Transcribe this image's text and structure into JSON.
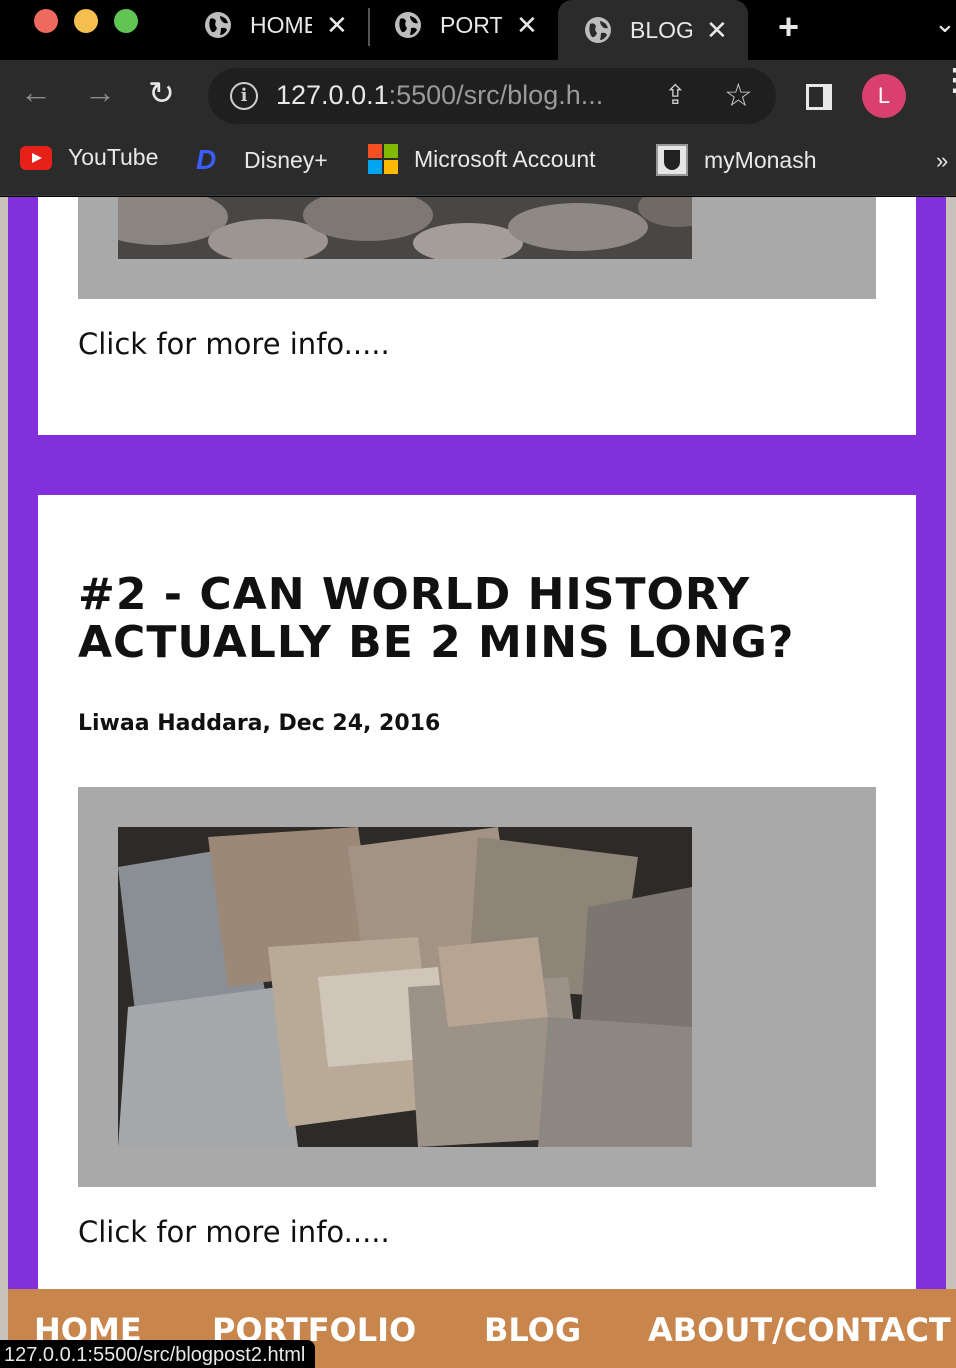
{
  "browser": {
    "tabs": [
      {
        "label": "HOME",
        "close": "✕"
      },
      {
        "label": "PORTFOLIO",
        "close": "✕"
      },
      {
        "label": "BLOG",
        "close": "✕"
      }
    ],
    "new_tab": "+",
    "tab_menu": "⌄",
    "nav": {
      "back": "←",
      "forward": "→",
      "reload": "↻"
    },
    "url_host": "127.0.0.1",
    "url_rest": ":5500/src/blog.h...",
    "share": "⇪",
    "star": "☆",
    "info": "i",
    "profile_initial": "L",
    "kebab": "⋮",
    "bookmarks": [
      {
        "label": "YouTube",
        "icon": "youtube-icon"
      },
      {
        "label": "Disney+",
        "icon": "disney-icon"
      },
      {
        "label": "Microsoft Account",
        "icon": "microsoft-icon"
      },
      {
        "label": "myMonash",
        "icon": "monash-icon"
      }
    ],
    "bookmarks_more": "»",
    "status_url": "127.0.0.1:5500/src/blogpost2.html"
  },
  "page": {
    "post1": {
      "more": "Click for more info....."
    },
    "post2": {
      "title": "#2 - CAN WORLD HISTORY ACTUALLY BE 2 MINS LONG?",
      "meta": "Liwaa Haddara, Dec 24, 2016",
      "more": "Click for more info....."
    },
    "nav": [
      "HOME",
      "PORTFOLIO",
      "BLOG",
      "ABOUT/CONTACT"
    ]
  },
  "colors": {
    "background_purple": "#8230dc",
    "nav_orange": "#c8864c",
    "image_frame": "#a9a9a9"
  }
}
